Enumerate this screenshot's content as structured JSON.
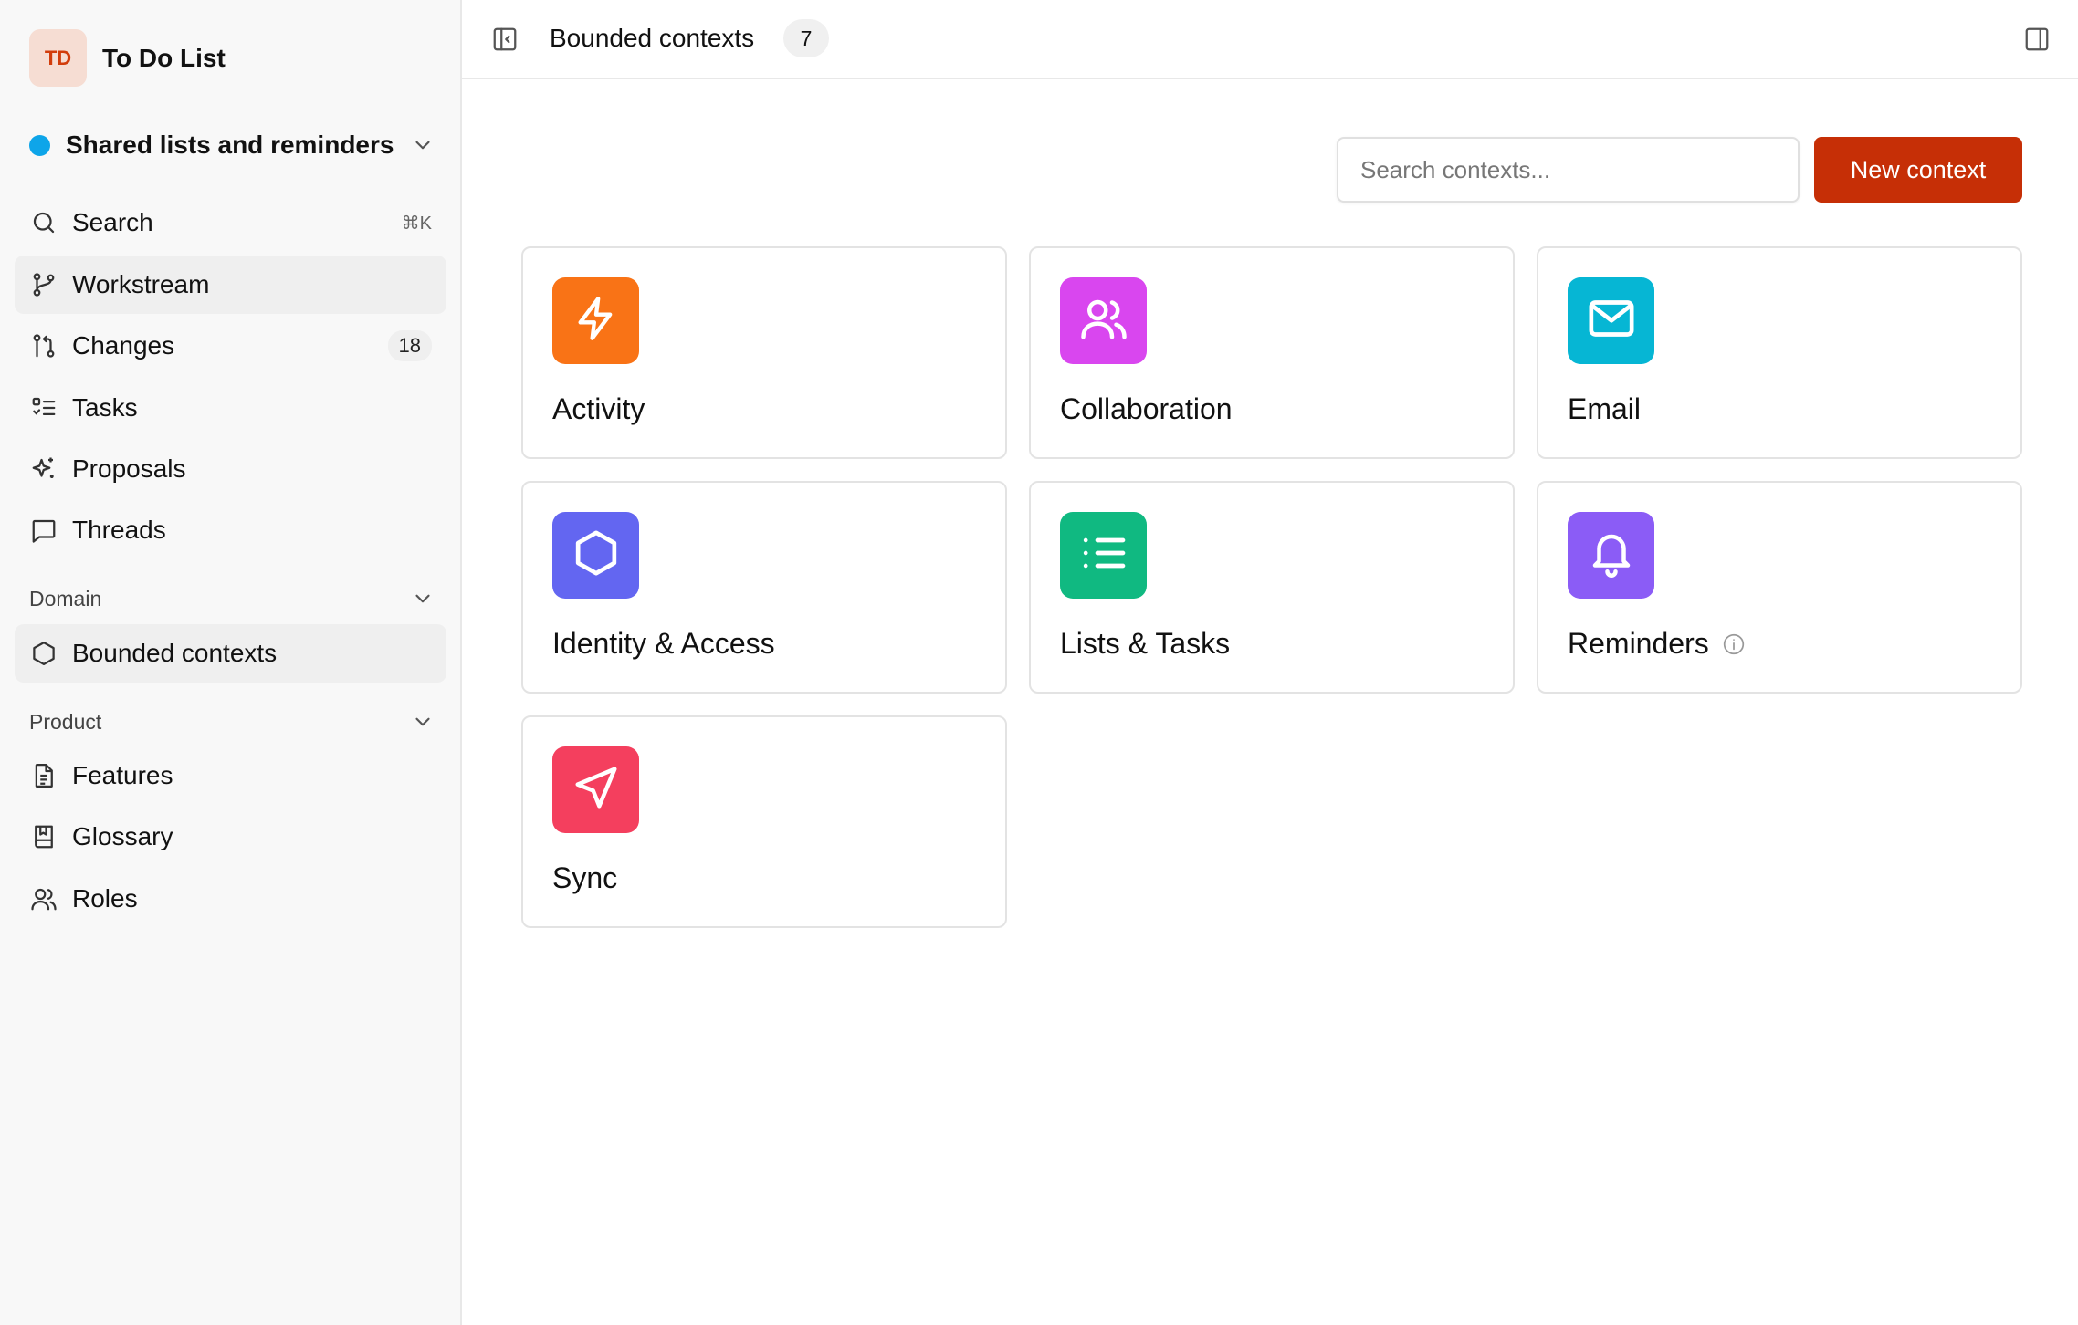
{
  "brand": {
    "initials": "TD",
    "name": "To Do List"
  },
  "project": {
    "name": "Shared lists and reminders",
    "dot_color": "#0ea5e9"
  },
  "nav": {
    "search": {
      "label": "Search",
      "shortcut": "⌘K"
    },
    "workstream": {
      "label": "Workstream"
    },
    "changes": {
      "label": "Changes",
      "count": "18"
    },
    "tasks": {
      "label": "Tasks"
    },
    "proposals": {
      "label": "Proposals"
    },
    "threads": {
      "label": "Threads"
    }
  },
  "sections": {
    "domain": {
      "label": "Domain",
      "items": {
        "bounded_contexts": "Bounded contexts"
      }
    },
    "product": {
      "label": "Product",
      "items": {
        "features": "Features",
        "glossary": "Glossary",
        "roles": "Roles"
      }
    }
  },
  "header": {
    "title": "Bounded contexts",
    "count": "7"
  },
  "toolbar": {
    "search_placeholder": "Search contexts...",
    "new_button": "New context"
  },
  "contexts": [
    {
      "name": "Activity",
      "icon": "lightning-icon",
      "color": "#f97316"
    },
    {
      "name": "Collaboration",
      "icon": "users-icon",
      "color": "#d946ef"
    },
    {
      "name": "Email",
      "icon": "mail-icon",
      "color": "#06b6d4"
    },
    {
      "name": "Identity & Access",
      "icon": "hexagon-icon",
      "color": "#6366f1"
    },
    {
      "name": "Lists & Tasks",
      "icon": "list-icon",
      "color": "#10b981"
    },
    {
      "name": "Reminders",
      "icon": "bell-icon",
      "color": "#8b5cf6",
      "has_info": true
    },
    {
      "name": "Sync",
      "icon": "send-icon",
      "color": "#f43f5e"
    }
  ],
  "colors": {
    "accent": "#c62f06",
    "active_nav_bg": "#efefef"
  }
}
